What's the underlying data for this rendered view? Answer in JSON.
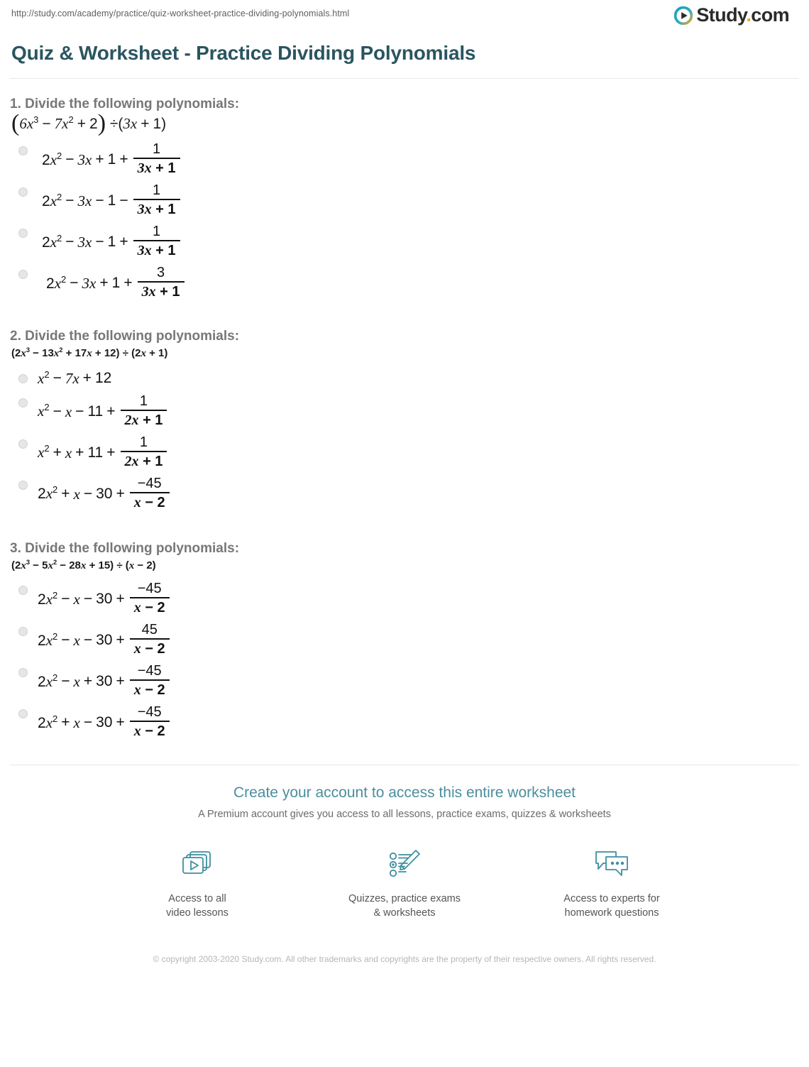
{
  "browser": {
    "url": "http://study.com/academy/practice/quiz-worksheet-practice-dividing-polynomials.html"
  },
  "brand": {
    "name": "Study",
    "dot": ".",
    "tld": "com",
    "logo_icon": "play-circle-icon",
    "accent_color": "#f5a623",
    "logo_teal": "#1b9dbb"
  },
  "header": {
    "title": "Quiz & Worksheet - Practice Dividing Polynomials",
    "title_color": "#2a5560"
  },
  "questions": [
    {
      "number": "1.",
      "prompt": "1. Divide the following polynomials:",
      "expression_plain": "(6x^3 - 7x^2 + 2) ÷ (3x + 1)",
      "expr_size": "big",
      "options": [
        {
          "text_plain": "2x^2 - 3x + 1 + 1/(3x + 1)",
          "numerator": "1",
          "denominator_plain": "3x + 1"
        },
        {
          "text_plain": "2x^2 - 3x - 1 - 1/(3x + 1)",
          "numerator": "1",
          "denominator_plain": "3x + 1"
        },
        {
          "text_plain": "2x^2 - 3x - 1 + 1/(3x + 1)",
          "numerator": "1",
          "denominator_plain": "3x + 1"
        },
        {
          "text_plain": "2x^2 - 3x + 1 + 3/(3x + 1)",
          "numerator": "3",
          "denominator_plain": "3x + 1"
        }
      ]
    },
    {
      "number": "2.",
      "prompt": "2. Divide the following polynomials:",
      "expression_plain": "(2x^3 - 13x^2 + 17x + 12) ÷ (2x + 1)",
      "expr_size": "small",
      "options": [
        {
          "text_plain": "x^2 - 7x + 12",
          "numerator": "",
          "denominator_plain": ""
        },
        {
          "text_plain": "x^2 - x - 11 + 1/(2x + 1)",
          "numerator": "1",
          "denominator_plain": "2x + 1"
        },
        {
          "text_plain": "x^2 + x + 11 + 1/(2x + 1)",
          "numerator": "1",
          "denominator_plain": "2x + 1"
        },
        {
          "text_plain": "2x^2 + x - 30 + (-45)/(x - 2)",
          "numerator": "−45",
          "denominator_plain": "x - 2"
        }
      ]
    },
    {
      "number": "3.",
      "prompt": "3. Divide the following polynomials:",
      "expression_plain": "(2x^3 - 5x^2 - 28x + 15) ÷ (x - 2)",
      "expr_size": "small",
      "options": [
        {
          "text_plain": "2x^2 - x - 30 + (-45)/(x - 2)",
          "numerator": "−45",
          "denominator_plain": "x - 2"
        },
        {
          "text_plain": "2x^2 - x - 30 + 45/(x - 2)",
          "numerator": "45",
          "denominator_plain": "x - 2"
        },
        {
          "text_plain": "2x^2 - x + 30 + (-45)/(x - 2)",
          "numerator": "−45",
          "denominator_plain": "x - 2"
        },
        {
          "text_plain": "2x^2 + x - 30 + (-45)/(x - 2)",
          "numerator": "−45",
          "denominator_plain": "x - 2"
        }
      ]
    }
  ],
  "footer": {
    "cta_link": "Create your account to access this entire worksheet",
    "cta_subtitle": "A Premium account gives you access to all lessons, practice exams, quizzes & worksheets",
    "link_color": "#4a8e9e",
    "perks": [
      {
        "icon": "video-lessons-icon",
        "label": "Access to all\nvideo lessons"
      },
      {
        "icon": "quiz-pencil-icon",
        "label": "Quizzes, practice exams\n& worksheets"
      },
      {
        "icon": "chat-bubbles-icon",
        "label": "Access to experts for\nhomework questions"
      }
    ],
    "copyright": "© copyright 2003-2020 Study.com. All other trademarks and copyrights are the property of their respective owners. All rights reserved."
  }
}
